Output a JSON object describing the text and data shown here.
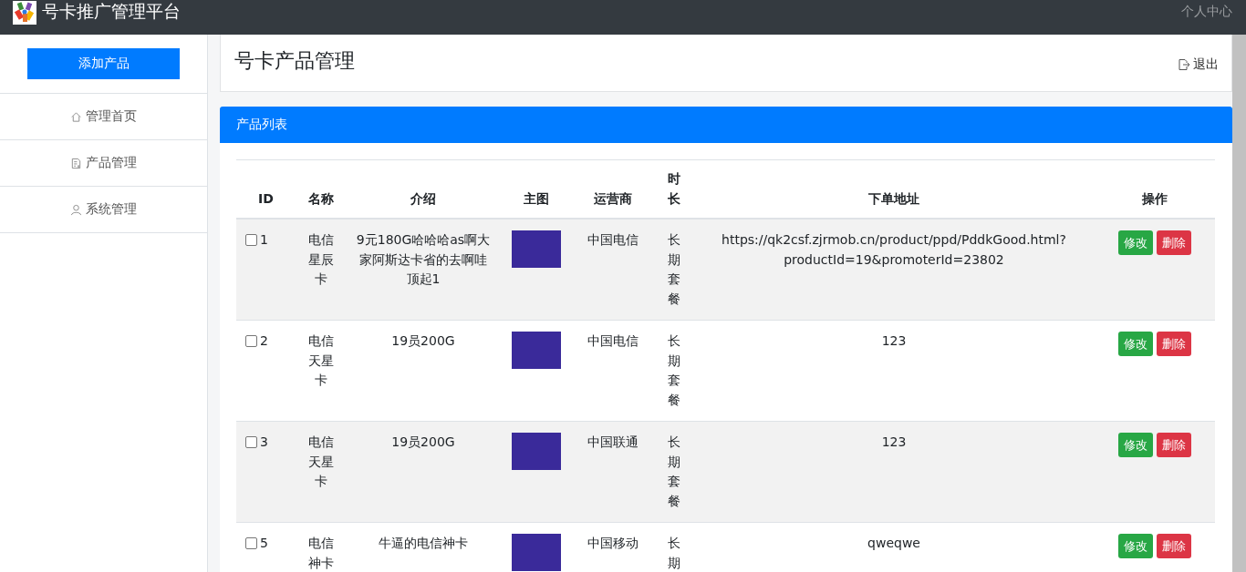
{
  "header": {
    "title": "号卡推广管理平台",
    "user_link": "个人中心"
  },
  "sidebar": {
    "add_button": "添加产品",
    "items": [
      {
        "label": "管理首页",
        "kind": "home"
      },
      {
        "label": "产品管理",
        "kind": "document"
      },
      {
        "label": "系统管理",
        "kind": "user"
      }
    ]
  },
  "page": {
    "title": "号卡产品管理",
    "logout": "退出"
  },
  "panel": {
    "title": "产品列表"
  },
  "table": {
    "columns": [
      "ID",
      "名称",
      "介绍",
      "主图",
      "运营商",
      "时长",
      "下单地址",
      "操作"
    ],
    "rows": [
      {
        "checked": false,
        "id": "1",
        "name": "电信星辰卡",
        "intro": "9元180G哈哈哈as啊大家阿斯达卡省的去啊哇顶起1",
        "carrier": "中国电信",
        "duration": "长期套餐",
        "url": "https://qk2csf.zjrmob.cn/product/ppd/PddkGood.html?productId=19&promoterId=23802",
        "edit": "修改",
        "delete": "删除"
      },
      {
        "checked": false,
        "id": "2",
        "name": "电信天星卡",
        "intro": "19员200G",
        "carrier": "中国电信",
        "duration": "长期套餐",
        "url": "123",
        "edit": "修改",
        "delete": "删除"
      },
      {
        "checked": false,
        "id": "3",
        "name": "电信天星卡",
        "intro": "19员200G",
        "carrier": "中国联通",
        "duration": "长期套餐",
        "url": "123",
        "edit": "修改",
        "delete": "删除"
      },
      {
        "checked": false,
        "id": "5",
        "name": "电信神卡",
        "intro": "牛逼的电信神卡",
        "carrier": "中国移动",
        "duration": "长期",
        "url": "qweqwe",
        "edit": "修改",
        "delete": "删除"
      }
    ]
  }
}
